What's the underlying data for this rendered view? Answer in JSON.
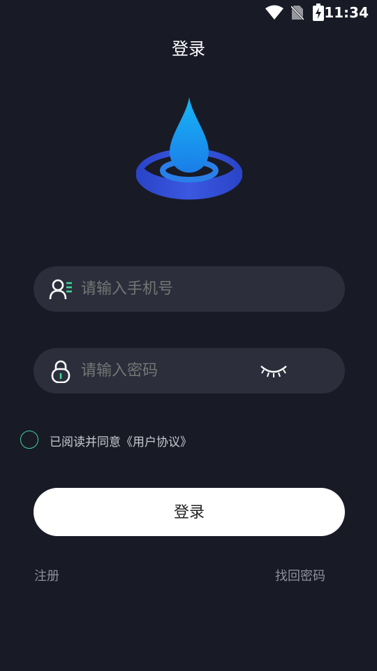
{
  "status_bar": {
    "time": "11:34",
    "icons": [
      "wifi-icon",
      "no-sim-icon",
      "battery-charging-icon"
    ]
  },
  "header": {
    "title": "登录"
  },
  "form": {
    "phone": {
      "placeholder": "请输入手机号",
      "icon": "user-id-icon"
    },
    "password": {
      "placeholder": "请输入密码",
      "icon": "lock-icon",
      "toggle_icon": "eye-closed-icon"
    },
    "agreement": {
      "text": "已阅读并同意《用户协议》",
      "checked": false
    }
  },
  "login_button": {
    "label": "登录"
  },
  "links": {
    "register": "注册",
    "forgot_password": "找回密码"
  },
  "colors": {
    "background": "#181a26",
    "field_bg": "#2c2f3b",
    "accent_green": "#3fd49a",
    "drop_blue": "#1a8ff0",
    "ring_blue": "#2f4fd6",
    "button_bg": "#ffffff"
  }
}
